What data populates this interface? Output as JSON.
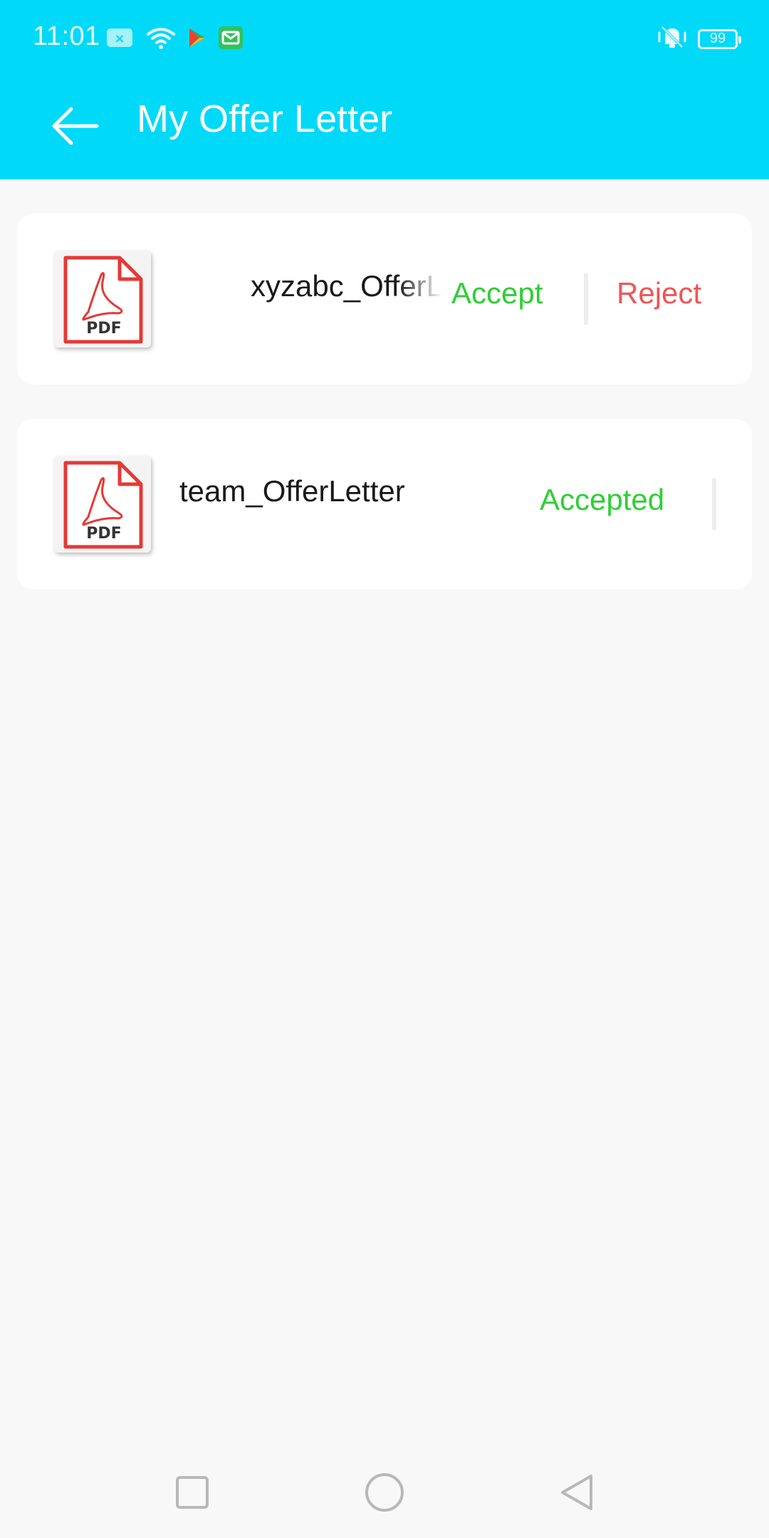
{
  "status_bar": {
    "time": "11:01",
    "battery_level": "99"
  },
  "app_bar": {
    "title": "My Offer Letter"
  },
  "offer_letters": [
    {
      "file_name": "xyzabc_OfferLetter",
      "file_type": "PDF",
      "accept_label": "Accept",
      "reject_label": "Reject"
    },
    {
      "file_name": "team_OfferLetter",
      "file_type": "PDF",
      "status_label": "Accepted"
    }
  ],
  "colors": {
    "header_background": "#00d9f8",
    "accept": "#2ecf36",
    "reject": "#f05555",
    "page_background": "#f8f8f8"
  }
}
